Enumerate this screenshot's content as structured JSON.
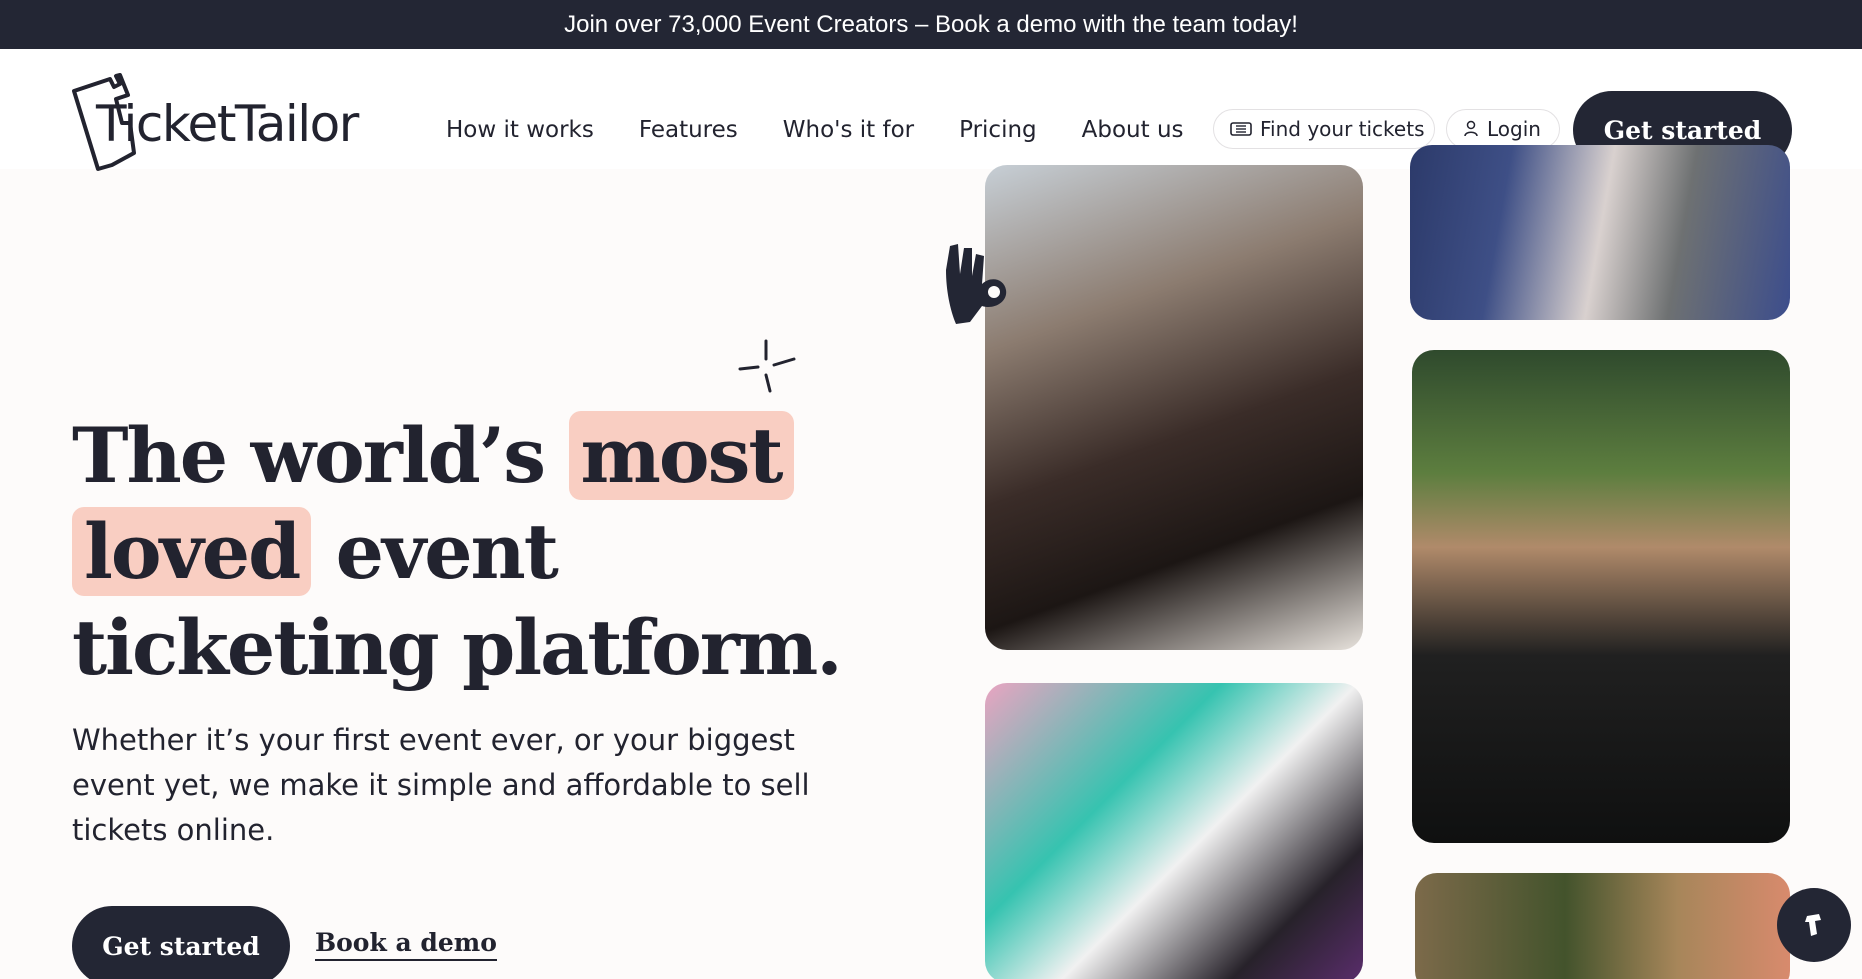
{
  "announcement": "Join over 73,000 Event Creators – Book a demo with the team today!",
  "brand": {
    "name": "TicketTailor"
  },
  "nav": {
    "items": [
      "How it works",
      "Features",
      "Who's it for",
      "Pricing",
      "About us"
    ]
  },
  "header_actions": {
    "find_tickets": "Find your tickets",
    "login": "Login",
    "get_started": "Get started"
  },
  "hero": {
    "title_part1": "The world’s ",
    "title_highlight1": "most",
    "title_highlight2": "loved",
    "title_part2": " event",
    "title_line3": "ticketing platform.",
    "subtitle": "Whether it’s your first event ever, or your biggest event yet, we make it simple and affordable to sell tickets online.",
    "cta_primary": "Get started",
    "cta_secondary": "Book a demo"
  },
  "colors": {
    "dark": "#232634",
    "highlight": "#f9cec2",
    "background": "#fdfbfa"
  },
  "icons": [
    "ticket-logo-icon",
    "ticket-icon",
    "user-icon",
    "sparkle-icon",
    "ok-hand-icon",
    "chat-widget-icon"
  ]
}
